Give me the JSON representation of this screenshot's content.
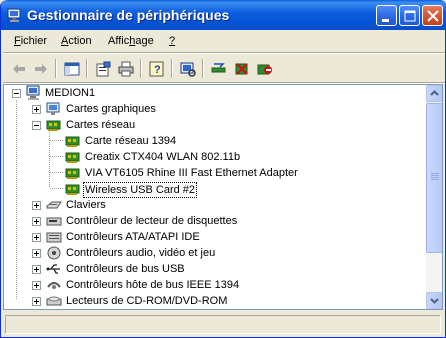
{
  "window": {
    "title": "Gestionnaire de périphériques",
    "title_icon": "device-manager-icon"
  },
  "title_buttons": {
    "minimize": "minimize",
    "maximize": "maximize",
    "close": "close"
  },
  "menu": [
    {
      "prefix": "",
      "accel": "F",
      "suffix": "ichier"
    },
    {
      "prefix": "",
      "accel": "A",
      "suffix": "ction"
    },
    {
      "prefix": "Affic",
      "accel": "h",
      "suffix": "age"
    },
    {
      "prefix": "",
      "accel": "?",
      "suffix": ""
    }
  ],
  "toolbar": [
    "back-arrow-icon",
    "forward-arrow-icon",
    "show-hide-tree-icon",
    "properties-icon",
    "print-icon",
    "help-icon",
    "scan-hardware-icon",
    "update-driver-icon",
    "uninstall-icon",
    "disable-device-icon"
  ],
  "tree": {
    "root": "MEDION1",
    "categories": [
      {
        "label": "Cartes graphiques",
        "expanded": false,
        "icon": "display-adapter-icon"
      },
      {
        "label": "Cartes réseau",
        "expanded": true,
        "icon": "network-adapter-icon",
        "children": [
          "Carte réseau 1394",
          "Creatix CTX404 WLAN 802.11b",
          "VIA VT6105 Rhine III Fast Ethernet Adapter",
          "Wireless USB Card #2"
        ]
      },
      {
        "label": "Claviers",
        "expanded": false,
        "icon": "keyboard-icon"
      },
      {
        "label": "Contrôleur de lecteur de disquettes",
        "expanded": false,
        "icon": "floppy-controller-icon"
      },
      {
        "label": "Contrôleurs ATA/ATAPI IDE",
        "expanded": false,
        "icon": "ide-controller-icon"
      },
      {
        "label": "Contrôleurs audio, vidéo et jeu",
        "expanded": false,
        "icon": "audio-icon"
      },
      {
        "label": "Contrôleurs de bus USB",
        "expanded": false,
        "icon": "usb-icon"
      },
      {
        "label": "Contrôleurs hôte de bus IEEE 1394",
        "expanded": false,
        "icon": "ieee1394-icon"
      },
      {
        "label": "Lecteurs de CD-ROM/DVD-ROM",
        "expanded": false,
        "icon": "cdrom-icon"
      }
    ],
    "selected": "Wireless USB Card #2"
  },
  "colors": {
    "titlebar": "#0454d6",
    "tree_border": "#7f9db9",
    "window_bg": "#ece9d8"
  }
}
